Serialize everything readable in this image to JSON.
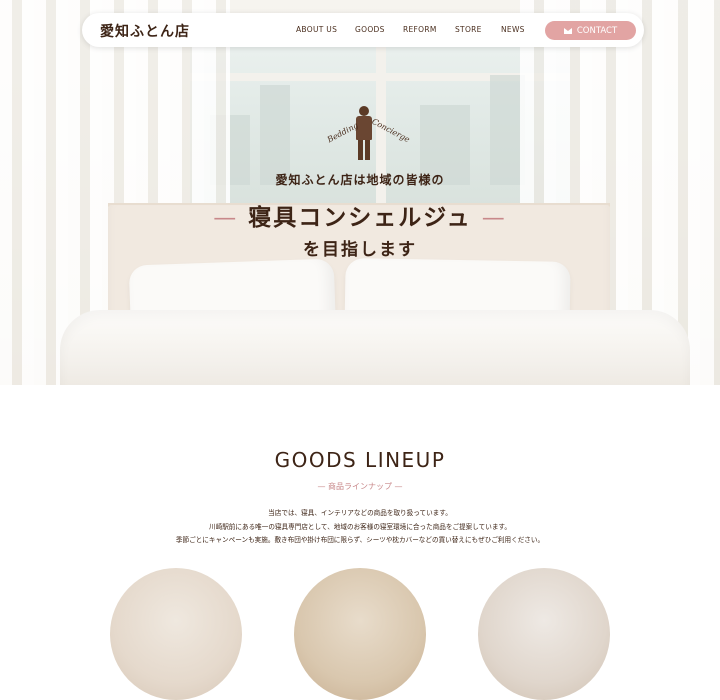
{
  "nav": {
    "logo": "愛知ふとん店",
    "items": [
      {
        "label": "ABOUT US"
      },
      {
        "label": "GOODS"
      },
      {
        "label": "REFORM"
      },
      {
        "label": "STORE"
      },
      {
        "label": "NEWS"
      }
    ],
    "contact_label": "CONTACT"
  },
  "hero": {
    "script_left": "Bedding",
    "script_right": "Concierge",
    "line1": "愛知ふとん店は地域の皆様の",
    "line2": "寝具コンシェルジュ",
    "line2_dash": "—",
    "line3": "を目指します"
  },
  "goods": {
    "title": "GOODS LINEUP",
    "subtitle": "— 商品ラインナップ —",
    "desc": [
      "当店では、寝具、インテリアなどの商品を取り扱っています。",
      "川崎駅前にある唯一の寝具専門店として、地域のお客様の寝室環境に合った商品をご提案しています。",
      "季節ごとにキャンペーンも実施。敷き布団や掛け布団に限らず、シーツや枕カバーなどの買い替えにもぜひご利用ください。"
    ]
  },
  "colors": {
    "accent": "#e2a4a3",
    "text": "#3d2416",
    "subtitle": "#c8888a"
  }
}
